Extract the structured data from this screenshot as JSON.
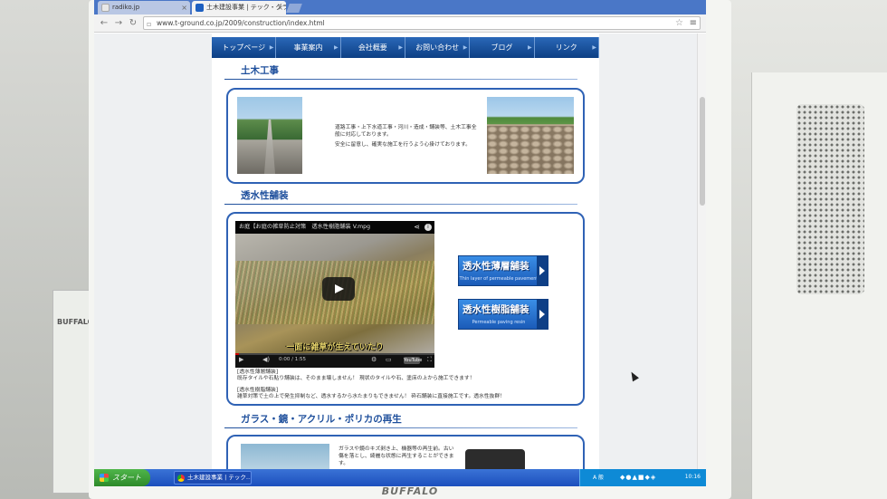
{
  "monitor": {
    "brand": "BUFFALO"
  },
  "router": {
    "brand": "BUFFALO"
  },
  "browser": {
    "tabs": [
      {
        "label": "radiko.jp",
        "active": false
      },
      {
        "label": "土木建設事業 | テック・グラ…",
        "active": true
      }
    ],
    "url": "www.t-ground.co.jp/2009/construction/index.html"
  },
  "nav": {
    "items": [
      "トップページ",
      "事業案内",
      "会社概要",
      "お問い合わせ",
      "ブログ",
      "リンク"
    ]
  },
  "sections": {
    "civil": {
      "title": "土木工事",
      "text1": "道路工事・上下水道工事・河川・造成・舗装等、土木工事全般に対応しております。",
      "text2": "安全に留意し、確実な施工を行うよう心掛けております。"
    },
    "permeable": {
      "title": "透水性舗装",
      "video": {
        "title": "お庭【お庭の雑草防止対策　透水性樹脂舗装 V.mpg",
        "caption": "一面に雑草が生えていたり",
        "time": "0:00 / 1:55",
        "yt_label": "YouTube"
      },
      "buttons": [
        {
          "main": "透水性薄層舗装",
          "sub": "Thin layer of permeable pavement"
        },
        {
          "main": "透水性樹脂舗装",
          "sub": "Permeable paving resin"
        }
      ],
      "desc": [
        "[透水性薄層舗装]",
        "既存タイルや石貼り舗装は、そのまま壊しません！ 現状のタイルや石、塗床の上から施工できます！",
        "[透水性樹脂舗装]",
        "雑草対策で土の上で発生抑制など、透水するから水たまりもできません！ 砕石舗装に直接施工です。透水性抜群！"
      ]
    },
    "glass": {
      "title": "ガラス・鏡・アクリル・ポリカの再生",
      "text": "ガラスや鏡のキズ剥き上、機器等の再生前。古い傷を落とし、綺麗な状態に再生することができます。"
    }
  },
  "taskbar": {
    "start": "スタート",
    "app": "土木建設事業 | テック…",
    "ime": "A 般",
    "clock": "10:16"
  }
}
